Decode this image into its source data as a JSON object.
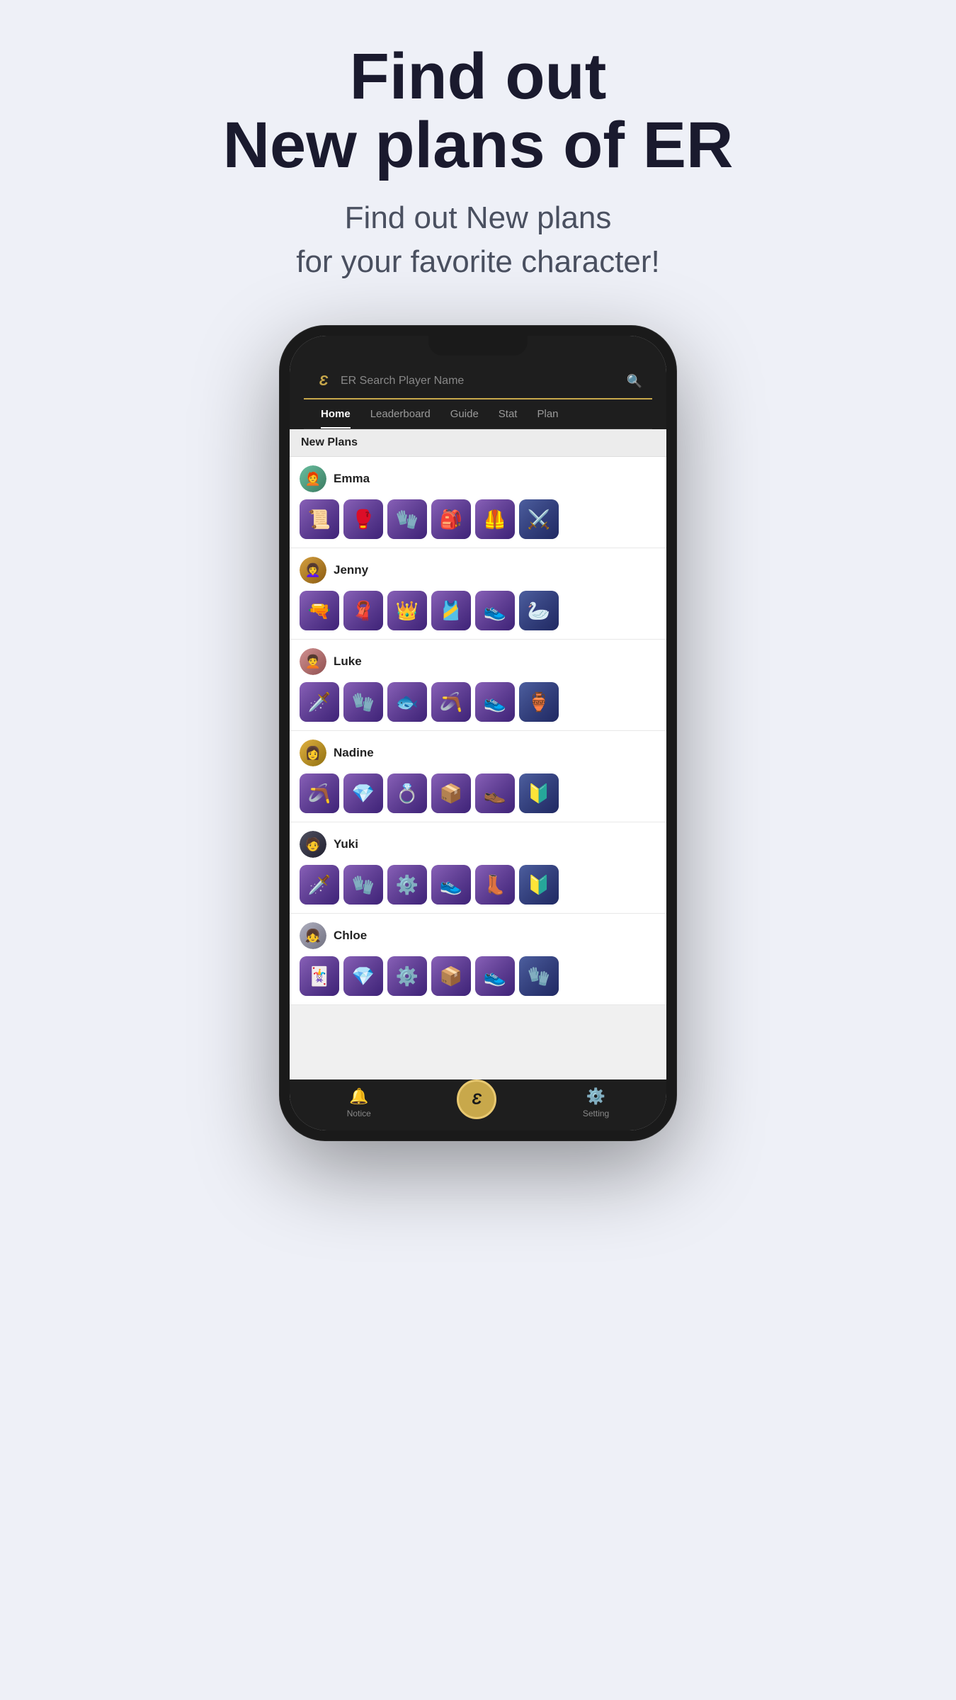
{
  "header": {
    "title_line1": "Find out",
    "title_line2": "New plans of ER",
    "subtitle_line1": "Find out New plans",
    "subtitle_line2": "for your favorite character!"
  },
  "app": {
    "logo": "Ɛ",
    "search_placeholder": "ER Search Player Name",
    "nav_tabs": [
      {
        "label": "Home",
        "active": true
      },
      {
        "label": "Leaderboard",
        "active": false
      },
      {
        "label": "Guide",
        "active": false
      },
      {
        "label": "Stat",
        "active": false
      },
      {
        "label": "Plan",
        "active": false
      }
    ],
    "section_title": "New Plans",
    "characters": [
      {
        "name": "Emma",
        "avatar_color": "#5a8a7a",
        "avatar_emoji": "👱‍♀️",
        "items": [
          "📜",
          "🥊",
          "🧤",
          "🎒",
          "🦺",
          "⚔️"
        ]
      },
      {
        "name": "Jenny",
        "avatar_color": "#b8862a",
        "avatar_emoji": "👩‍🦱",
        "items": [
          "🔫",
          "🧣",
          "👑",
          "🎽",
          "👟",
          "🦢"
        ]
      },
      {
        "name": "Luke",
        "avatar_color": "#c08080",
        "avatar_emoji": "🧑‍🦱",
        "items": [
          "🗡️",
          "🧤",
          "🐟",
          "🪃",
          "👟",
          "🏺"
        ]
      },
      {
        "name": "Nadine",
        "avatar_color": "#c8a020",
        "avatar_emoji": "👩",
        "items": [
          "🪃",
          "💎",
          "💍",
          "📦",
          "👞",
          "🔰"
        ]
      },
      {
        "name": "Yuki",
        "avatar_color": "#3a3a3a",
        "avatar_emoji": "🧑",
        "items": [
          "🗡️",
          "🧤",
          "⚙️",
          "👟",
          "👢",
          "🔰"
        ]
      },
      {
        "name": "Chloe",
        "avatar_color": "#a0a0b0",
        "avatar_emoji": "👧",
        "items": [
          "🃏",
          "💎",
          "⚙️",
          "📦",
          "👟",
          "🧤"
        ]
      }
    ],
    "bottom_nav": {
      "notice_label": "Notice",
      "center_logo": "Ɛ",
      "setting_label": "Setting"
    }
  }
}
